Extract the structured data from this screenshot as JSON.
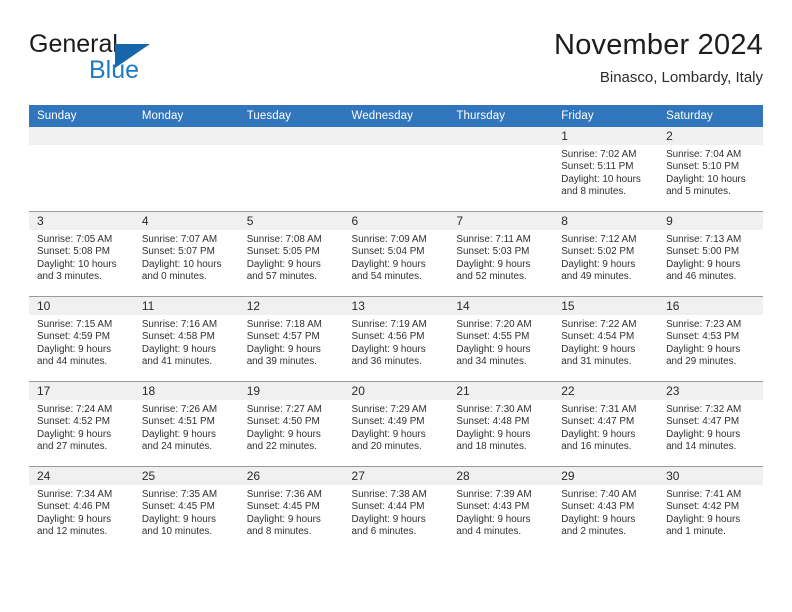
{
  "brand": {
    "name_part1": "General",
    "name_part2": "Blue",
    "accent_color": "#1566ab",
    "text_color": "#1f7ac4"
  },
  "header": {
    "title": "November 2024",
    "subtitle": "Binasco, Lombardy, Italy",
    "header_bg": "#3176bc",
    "header_text": "#ffffff"
  },
  "weekdays": [
    "Sunday",
    "Monday",
    "Tuesday",
    "Wednesday",
    "Thursday",
    "Friday",
    "Saturday"
  ],
  "weeks": [
    [
      {
        "day": "",
        "sunrise": "",
        "sunset": "",
        "daylight1": "",
        "daylight2": ""
      },
      {
        "day": "",
        "sunrise": "",
        "sunset": "",
        "daylight1": "",
        "daylight2": ""
      },
      {
        "day": "",
        "sunrise": "",
        "sunset": "",
        "daylight1": "",
        "daylight2": ""
      },
      {
        "day": "",
        "sunrise": "",
        "sunset": "",
        "daylight1": "",
        "daylight2": ""
      },
      {
        "day": "",
        "sunrise": "",
        "sunset": "",
        "daylight1": "",
        "daylight2": ""
      },
      {
        "day": "1",
        "sunrise": "Sunrise: 7:02 AM",
        "sunset": "Sunset: 5:11 PM",
        "daylight1": "Daylight: 10 hours",
        "daylight2": "and 8 minutes."
      },
      {
        "day": "2",
        "sunrise": "Sunrise: 7:04 AM",
        "sunset": "Sunset: 5:10 PM",
        "daylight1": "Daylight: 10 hours",
        "daylight2": "and 5 minutes."
      }
    ],
    [
      {
        "day": "3",
        "sunrise": "Sunrise: 7:05 AM",
        "sunset": "Sunset: 5:08 PM",
        "daylight1": "Daylight: 10 hours",
        "daylight2": "and 3 minutes."
      },
      {
        "day": "4",
        "sunrise": "Sunrise: 7:07 AM",
        "sunset": "Sunset: 5:07 PM",
        "daylight1": "Daylight: 10 hours",
        "daylight2": "and 0 minutes."
      },
      {
        "day": "5",
        "sunrise": "Sunrise: 7:08 AM",
        "sunset": "Sunset: 5:05 PM",
        "daylight1": "Daylight: 9 hours",
        "daylight2": "and 57 minutes."
      },
      {
        "day": "6",
        "sunrise": "Sunrise: 7:09 AM",
        "sunset": "Sunset: 5:04 PM",
        "daylight1": "Daylight: 9 hours",
        "daylight2": "and 54 minutes."
      },
      {
        "day": "7",
        "sunrise": "Sunrise: 7:11 AM",
        "sunset": "Sunset: 5:03 PM",
        "daylight1": "Daylight: 9 hours",
        "daylight2": "and 52 minutes."
      },
      {
        "day": "8",
        "sunrise": "Sunrise: 7:12 AM",
        "sunset": "Sunset: 5:02 PM",
        "daylight1": "Daylight: 9 hours",
        "daylight2": "and 49 minutes."
      },
      {
        "day": "9",
        "sunrise": "Sunrise: 7:13 AM",
        "sunset": "Sunset: 5:00 PM",
        "daylight1": "Daylight: 9 hours",
        "daylight2": "and 46 minutes."
      }
    ],
    [
      {
        "day": "10",
        "sunrise": "Sunrise: 7:15 AM",
        "sunset": "Sunset: 4:59 PM",
        "daylight1": "Daylight: 9 hours",
        "daylight2": "and 44 minutes."
      },
      {
        "day": "11",
        "sunrise": "Sunrise: 7:16 AM",
        "sunset": "Sunset: 4:58 PM",
        "daylight1": "Daylight: 9 hours",
        "daylight2": "and 41 minutes."
      },
      {
        "day": "12",
        "sunrise": "Sunrise: 7:18 AM",
        "sunset": "Sunset: 4:57 PM",
        "daylight1": "Daylight: 9 hours",
        "daylight2": "and 39 minutes."
      },
      {
        "day": "13",
        "sunrise": "Sunrise: 7:19 AM",
        "sunset": "Sunset: 4:56 PM",
        "daylight1": "Daylight: 9 hours",
        "daylight2": "and 36 minutes."
      },
      {
        "day": "14",
        "sunrise": "Sunrise: 7:20 AM",
        "sunset": "Sunset: 4:55 PM",
        "daylight1": "Daylight: 9 hours",
        "daylight2": "and 34 minutes."
      },
      {
        "day": "15",
        "sunrise": "Sunrise: 7:22 AM",
        "sunset": "Sunset: 4:54 PM",
        "daylight1": "Daylight: 9 hours",
        "daylight2": "and 31 minutes."
      },
      {
        "day": "16",
        "sunrise": "Sunrise: 7:23 AM",
        "sunset": "Sunset: 4:53 PM",
        "daylight1": "Daylight: 9 hours",
        "daylight2": "and 29 minutes."
      }
    ],
    [
      {
        "day": "17",
        "sunrise": "Sunrise: 7:24 AM",
        "sunset": "Sunset: 4:52 PM",
        "daylight1": "Daylight: 9 hours",
        "daylight2": "and 27 minutes."
      },
      {
        "day": "18",
        "sunrise": "Sunrise: 7:26 AM",
        "sunset": "Sunset: 4:51 PM",
        "daylight1": "Daylight: 9 hours",
        "daylight2": "and 24 minutes."
      },
      {
        "day": "19",
        "sunrise": "Sunrise: 7:27 AM",
        "sunset": "Sunset: 4:50 PM",
        "daylight1": "Daylight: 9 hours",
        "daylight2": "and 22 minutes."
      },
      {
        "day": "20",
        "sunrise": "Sunrise: 7:29 AM",
        "sunset": "Sunset: 4:49 PM",
        "daylight1": "Daylight: 9 hours",
        "daylight2": "and 20 minutes."
      },
      {
        "day": "21",
        "sunrise": "Sunrise: 7:30 AM",
        "sunset": "Sunset: 4:48 PM",
        "daylight1": "Daylight: 9 hours",
        "daylight2": "and 18 minutes."
      },
      {
        "day": "22",
        "sunrise": "Sunrise: 7:31 AM",
        "sunset": "Sunset: 4:47 PM",
        "daylight1": "Daylight: 9 hours",
        "daylight2": "and 16 minutes."
      },
      {
        "day": "23",
        "sunrise": "Sunrise: 7:32 AM",
        "sunset": "Sunset: 4:47 PM",
        "daylight1": "Daylight: 9 hours",
        "daylight2": "and 14 minutes."
      }
    ],
    [
      {
        "day": "24",
        "sunrise": "Sunrise: 7:34 AM",
        "sunset": "Sunset: 4:46 PM",
        "daylight1": "Daylight: 9 hours",
        "daylight2": "and 12 minutes."
      },
      {
        "day": "25",
        "sunrise": "Sunrise: 7:35 AM",
        "sunset": "Sunset: 4:45 PM",
        "daylight1": "Daylight: 9 hours",
        "daylight2": "and 10 minutes."
      },
      {
        "day": "26",
        "sunrise": "Sunrise: 7:36 AM",
        "sunset": "Sunset: 4:45 PM",
        "daylight1": "Daylight: 9 hours",
        "daylight2": "and 8 minutes."
      },
      {
        "day": "27",
        "sunrise": "Sunrise: 7:38 AM",
        "sunset": "Sunset: 4:44 PM",
        "daylight1": "Daylight: 9 hours",
        "daylight2": "and 6 minutes."
      },
      {
        "day": "28",
        "sunrise": "Sunrise: 7:39 AM",
        "sunset": "Sunset: 4:43 PM",
        "daylight1": "Daylight: 9 hours",
        "daylight2": "and 4 minutes."
      },
      {
        "day": "29",
        "sunrise": "Sunrise: 7:40 AM",
        "sunset": "Sunset: 4:43 PM",
        "daylight1": "Daylight: 9 hours",
        "daylight2": "and 2 minutes."
      },
      {
        "day": "30",
        "sunrise": "Sunrise: 7:41 AM",
        "sunset": "Sunset: 4:42 PM",
        "daylight1": "Daylight: 9 hours",
        "daylight2": "and 1 minute."
      }
    ]
  ]
}
